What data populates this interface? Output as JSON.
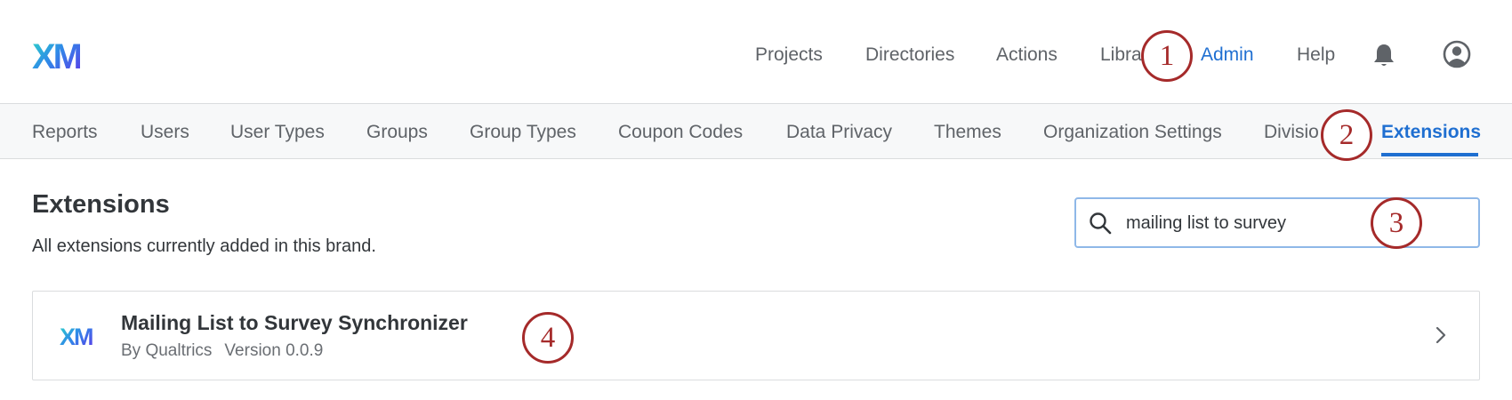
{
  "header": {
    "logo_text": "XM",
    "nav": [
      "Projects",
      "Directories",
      "Actions",
      "Libra",
      "Admin",
      "Help"
    ],
    "active_nav": "Admin",
    "icons": [
      "bell-icon",
      "profile-icon"
    ]
  },
  "tabs": {
    "items": [
      "Reports",
      "Users",
      "User Types",
      "Groups",
      "Group Types",
      "Coupon Codes",
      "Data Privacy",
      "Themes",
      "Organization Settings",
      "Divisio",
      "Extensions"
    ],
    "active": "Extensions"
  },
  "page": {
    "title": "Extensions",
    "subtitle": "All extensions currently added in this brand."
  },
  "search": {
    "value": "mailing list to survey",
    "icon": "search-icon"
  },
  "extension": {
    "logo_text": "XM",
    "name": "Mailing List to Survey Synchronizer",
    "author": "By Qualtrics",
    "version": "Version 0.0.9",
    "icon": "chevron-right-icon"
  },
  "markers": [
    "1",
    "2",
    "3",
    "4"
  ],
  "colors": {
    "accent": "#1f6fd1",
    "marker": "#a52a2a",
    "text": "#32363a",
    "muted": "#5f6368"
  }
}
